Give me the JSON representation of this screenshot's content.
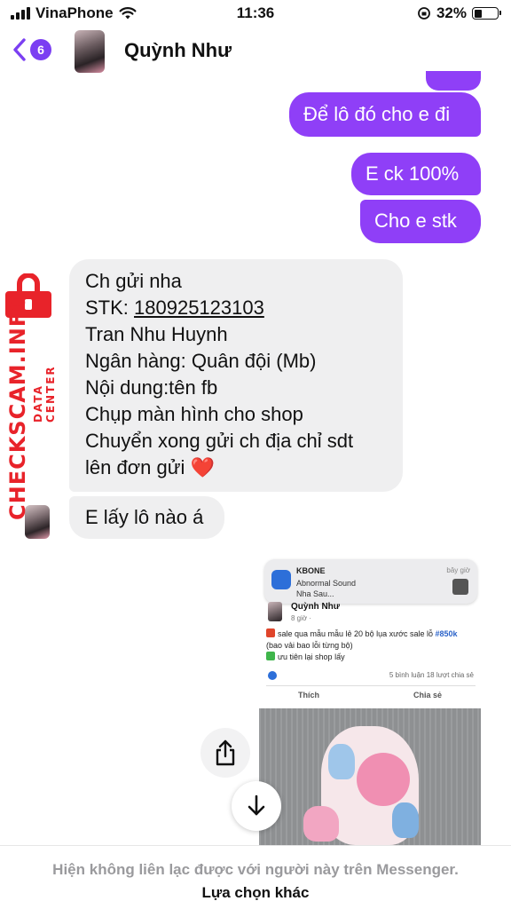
{
  "status_bar": {
    "carrier": "VinaPhone",
    "time": "11:36",
    "battery": "32%",
    "battery_level": 0.32
  },
  "header": {
    "unread_count": "6",
    "contact_name": "Quỳnh Như"
  },
  "messages": [
    {
      "side": "out",
      "text": "Để lô đó cho e đi"
    },
    {
      "side": "out",
      "text": "E ck 100%"
    },
    {
      "side": "out",
      "text": "Cho e stk"
    },
    {
      "side": "in",
      "lines": [
        "Ch gửi nha",
        "STK: ",
        "Tran Nhu Huynh",
        "Ngân hàng: Quân đội (Mb)",
        "Nội dung:tên fb",
        "Chụp màn hình cho shop",
        "Chuyển xong gửi ch địa chỉ sdt",
        "lên đơn gửi ❤️"
      ],
      "account_number": "180925123103"
    },
    {
      "side": "in",
      "text": "E lấy lô nào á"
    }
  ],
  "watermark": {
    "brand": "CHECKSCAM.INFO",
    "sub": "DATA CENTER"
  },
  "attachment": {
    "notification": {
      "app": "KBONE",
      "time": "bây giờ",
      "line1": "Abnormal Sound",
      "line2": "Nha Sau..."
    },
    "post": {
      "author": "Quỳnh Như",
      "meta": "8 giờ · ",
      "text_a": "sale qua mẫu mẫu lẻ 20 bộ lụa xước sale lỗ ",
      "price": "#850k",
      "text_b": "(bao vải bao lỗi từng bộ)",
      "text_c": "ưu tiên lại shop lấy",
      "comments": "5 bình luận   18 lượt chia sẻ",
      "like_label": "Thích",
      "share_label": "Chia sẻ"
    }
  },
  "footer": {
    "notice": "Hiện không liên lạc được với người này trên Messenger.",
    "other_options": "Lựa chọn khác"
  },
  "colors": {
    "accent": "#8f3ff7",
    "incoming_bubble": "#efeff0",
    "watermark": "#e8232a"
  }
}
